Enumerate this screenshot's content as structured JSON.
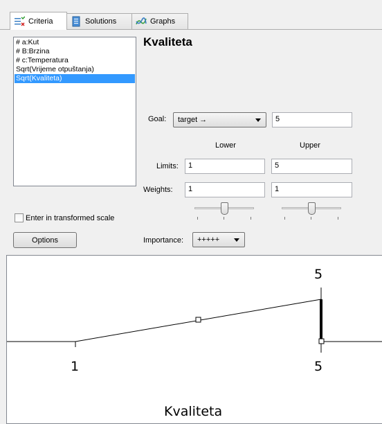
{
  "tabs": [
    {
      "label": "Criteria",
      "icon": "criteria-icon",
      "active": true
    },
    {
      "label": "Solutions",
      "icon": "solutions-icon",
      "active": false
    },
    {
      "label": "Graphs",
      "icon": "graphs-icon",
      "active": false
    }
  ],
  "criteria_list": {
    "items": [
      {
        "label": "# a:Kut",
        "selected": false
      },
      {
        "label": "# B:Brzina",
        "selected": false
      },
      {
        "label": "# c:Temperatura",
        "selected": false
      },
      {
        "label": "Sqrt(Vrijeme otpuštanja)",
        "selected": false
      },
      {
        "label": "Sqrt(Kvaliteta)",
        "selected": true
      }
    ]
  },
  "criterion": {
    "title": "Kvaliteta",
    "goal_label": "Goal:",
    "goal_value": "target →",
    "target_value": "5",
    "lower_header": "Lower",
    "upper_header": "Upper",
    "limits_label": "Limits:",
    "limits_lower": "1",
    "limits_upper": "5",
    "weights_label": "Weights:",
    "weights_lower": "1",
    "weights_upper": "1",
    "weight_slider_lower_level": 0.5,
    "weight_slider_upper_level": 0.5,
    "importance_label": "Importance:",
    "importance_value": "+++++"
  },
  "transformed_scale": {
    "label": "Enter in transformed scale",
    "checked": false
  },
  "options_button": {
    "label": "Options"
  },
  "graph": {
    "top_value_label": "5",
    "lower_limit_label": "1",
    "upper_limit_label": "5",
    "axis_title": "Kvaliteta"
  }
}
